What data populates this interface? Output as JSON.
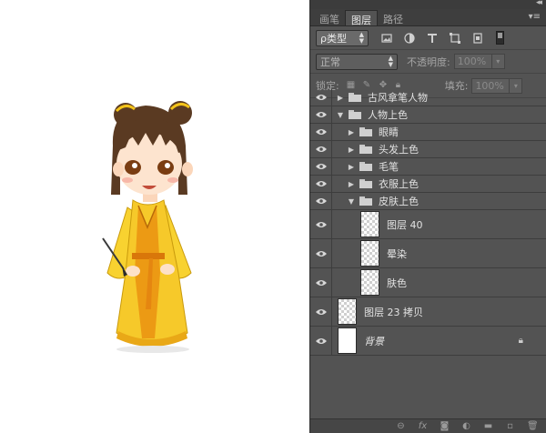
{
  "panel": {
    "collapse_glyph": "◂◂",
    "menu_glyph": "▾≡",
    "tabs": [
      {
        "label": "画笔",
        "active": false
      },
      {
        "label": "图层",
        "active": true
      },
      {
        "label": "路径",
        "active": false
      }
    ],
    "filter": {
      "kind_label": "ρ类型",
      "icons": [
        "image-filter-icon",
        "adjustment-filter-icon",
        "type-filter-icon",
        "shape-filter-icon",
        "smart-object-filter-icon"
      ]
    },
    "blend": {
      "mode": "正常",
      "opacity_label": "不透明度:",
      "opacity_value": "100%"
    },
    "lock": {
      "label": "锁定:",
      "fill_label": "填充:",
      "fill_value": "100%"
    },
    "layers": [
      {
        "name": "古风拿笔人物",
        "kind": "group",
        "expanded": false,
        "indent": 0
      },
      {
        "name": "人物上色",
        "kind": "group",
        "expanded": true,
        "indent": 0
      },
      {
        "name": "眼睛",
        "kind": "group",
        "expanded": false,
        "indent": 1
      },
      {
        "name": "头发上色",
        "kind": "group",
        "expanded": false,
        "indent": 1
      },
      {
        "name": "毛笔",
        "kind": "group",
        "expanded": false,
        "indent": 1
      },
      {
        "name": "衣服上色",
        "kind": "group",
        "expanded": false,
        "indent": 1
      },
      {
        "name": "皮肤上色",
        "kind": "group",
        "expanded": true,
        "indent": 1
      },
      {
        "name": "图层 40",
        "kind": "layer",
        "indent": 2
      },
      {
        "name": "晕染",
        "kind": "layer",
        "indent": 2
      },
      {
        "name": "肤色",
        "kind": "layer",
        "indent": 2
      },
      {
        "name": "图层 23 拷贝",
        "kind": "layer",
        "indent": 0
      },
      {
        "name": "背景",
        "kind": "background",
        "indent": 0,
        "locked": true
      }
    ],
    "bottom_icons": [
      "link-icon",
      "fx-icon",
      "mask-icon",
      "adjustment-icon",
      "new-group-icon",
      "new-layer-icon",
      "trash-icon"
    ],
    "bottom_glyphs": [
      "⊖",
      "fx",
      "◙",
      "◐",
      "▬",
      "▫",
      "🗑"
    ]
  },
  "colors": {
    "panel_bg": "#535353",
    "robe": "#f5c518",
    "robe_dark": "#e08a0c",
    "hair": "#5a3a22"
  }
}
